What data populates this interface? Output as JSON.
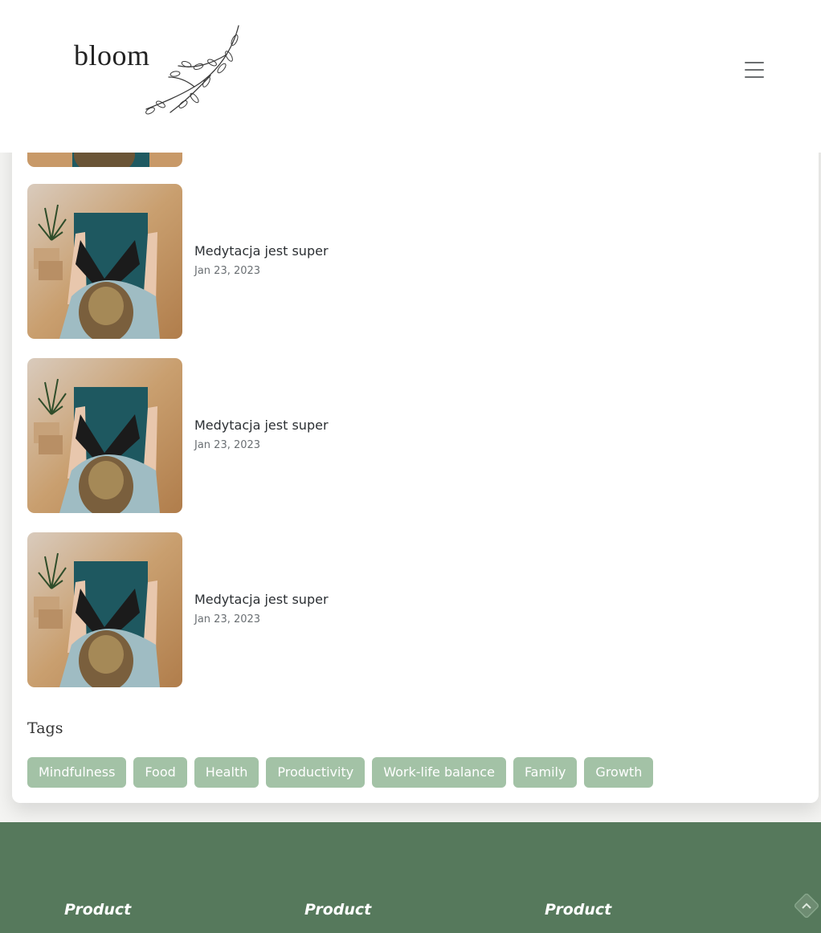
{
  "header": {
    "logo_text": "bloom"
  },
  "posts": [
    {
      "title": "Medytacja jest super",
      "date": "Jan 23, 2023"
    },
    {
      "title": "Medytacja jest super",
      "date": "Jan 23, 2023"
    },
    {
      "title": "Medytacja jest super",
      "date": "Jan 23, 2023"
    }
  ],
  "tags": {
    "heading": "Tags",
    "items": [
      "Mindfulness",
      "Food",
      "Health",
      "Productivity",
      "Work-life balance",
      "Family",
      "Growth"
    ]
  },
  "footer": {
    "columns": [
      "Product",
      "Product",
      "Product"
    ]
  },
  "colors": {
    "tag_bg": "#a3c2a6",
    "footer_bg": "#56795c"
  }
}
